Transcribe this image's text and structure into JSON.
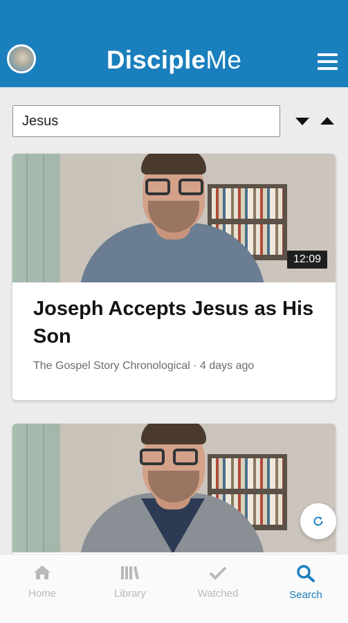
{
  "app": {
    "logo_bold": "Disciple",
    "logo_light": "Me"
  },
  "search": {
    "value": "Jesus"
  },
  "results": [
    {
      "duration": "12:09",
      "title": "Joseph Accepts Jesus as His Son",
      "meta": "The Gospel Story Chronological · 4 days ago"
    }
  ],
  "nav": {
    "items": [
      {
        "label": "Home",
        "icon": "home-icon"
      },
      {
        "label": "Library",
        "icon": "library-icon"
      },
      {
        "label": "Watched",
        "icon": "check-icon"
      },
      {
        "label": "Search",
        "icon": "search-icon",
        "active": true
      }
    ]
  },
  "colors": {
    "brand": "#1a7fbd",
    "nav_inactive": "#b9b9b9"
  }
}
